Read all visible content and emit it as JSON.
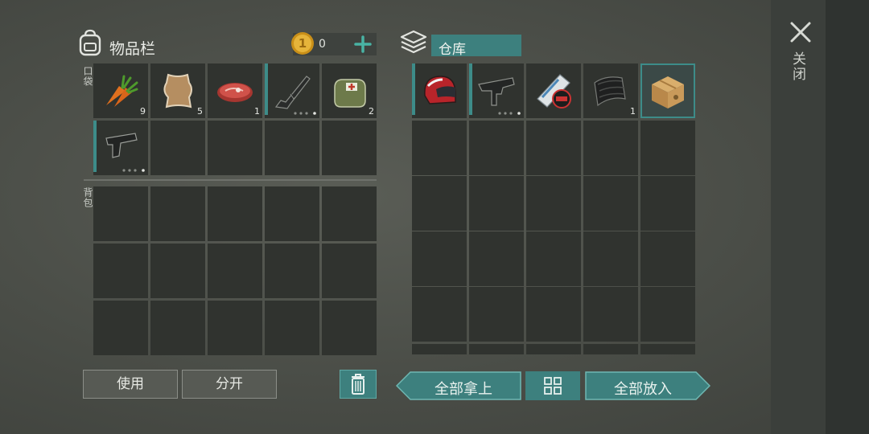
{
  "inventory": {
    "title": "物品栏",
    "pocket_label": "口袋",
    "backpack_label": "背包"
  },
  "currency": {
    "count": "0"
  },
  "storage": {
    "title": "仓库"
  },
  "close": {
    "label": "关闭"
  },
  "pocket_items": [
    {
      "name": "carrot",
      "count": "9"
    },
    {
      "name": "animal-hide",
      "count": "5"
    },
    {
      "name": "raw-meat",
      "count": "1"
    },
    {
      "name": "assault-rifle",
      "durability": 0.75
    },
    {
      "name": "first-aid-bag",
      "count": "2"
    },
    {
      "name": "pistol",
      "durability": 0.75
    }
  ],
  "storage_items": [
    {
      "name": "motorcycle-helmet"
    },
    {
      "name": "submachine-gun",
      "durability": 0.75
    },
    {
      "name": "magazine-last-day"
    },
    {
      "name": "rubber-sheet",
      "count": "1"
    },
    {
      "name": "cardboard-box",
      "selected": true
    }
  ],
  "buttons": {
    "use": "使用",
    "split": "分开",
    "take_all": "全部拿上",
    "put_all": "全部放入"
  },
  "colors": {
    "accent": "#3d807e",
    "slot": "#30332f"
  },
  "icons": {
    "close": "close-icon",
    "coin": "coin-icon",
    "trash": "trash-icon",
    "sort": "grid-sort-icon"
  }
}
